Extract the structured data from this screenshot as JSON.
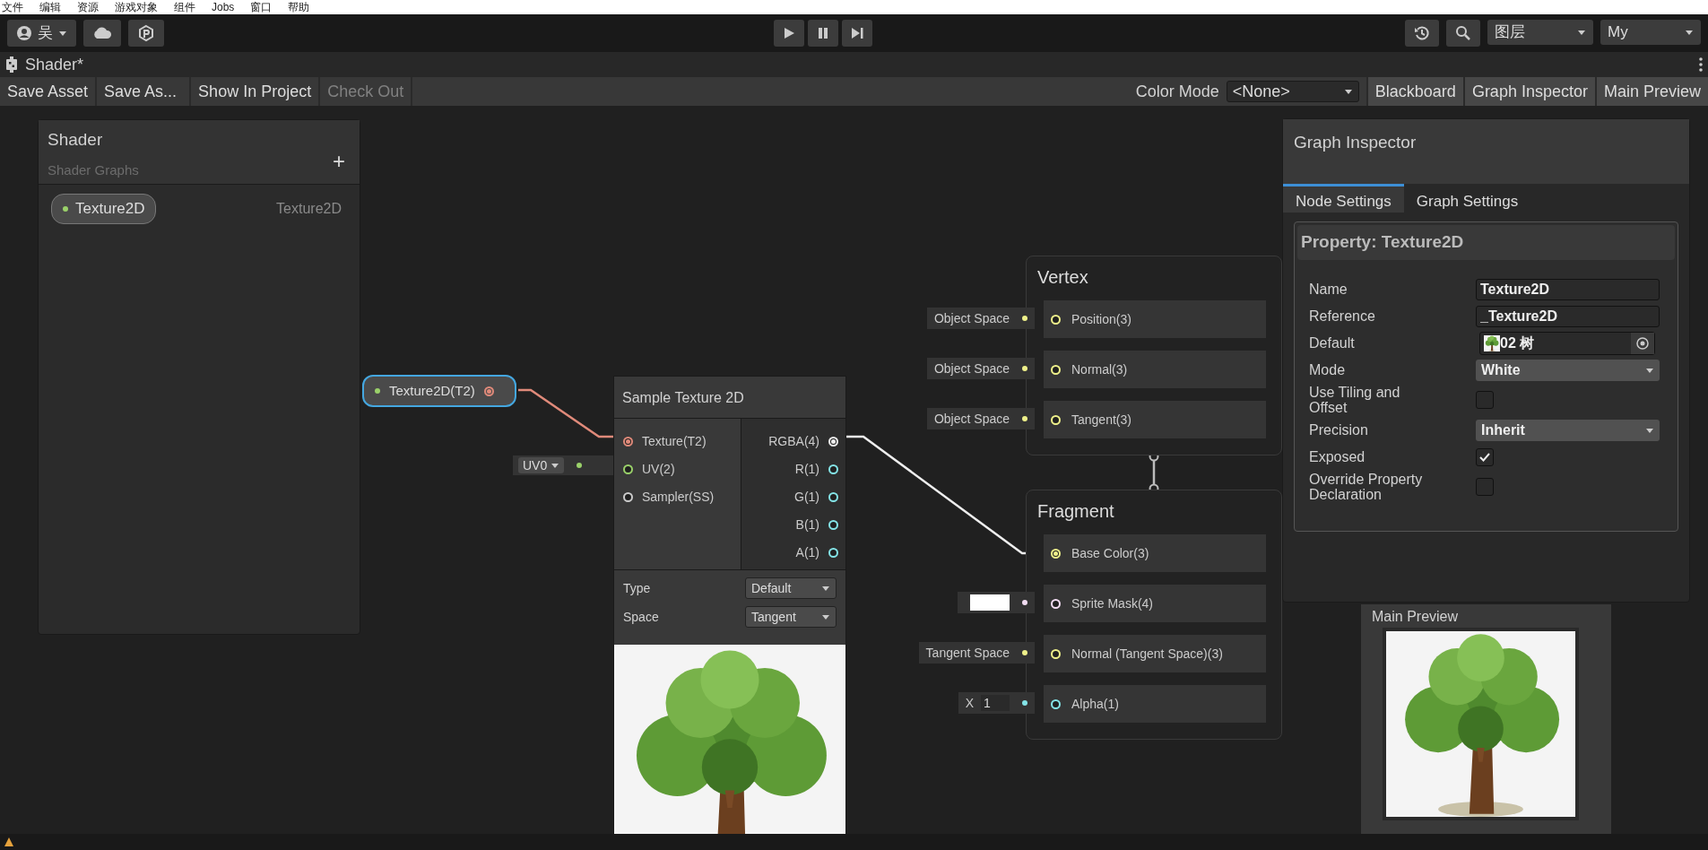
{
  "menu_bar": [
    "文件",
    "编辑",
    "资源",
    "游戏对象",
    "组件",
    "Jobs",
    "窗口",
    "帮助"
  ],
  "toolbar": {
    "account": "吴",
    "layers": "图层",
    "layout": "My"
  },
  "tab": {
    "title": "Shader*"
  },
  "actions": [
    {
      "label": "Save Asset",
      "disabled": false
    },
    {
      "label": "Save As...",
      "disabled": false
    },
    {
      "label": "Show In Project",
      "disabled": false
    },
    {
      "label": "Check Out",
      "disabled": true
    }
  ],
  "color_mode": {
    "label": "Color Mode",
    "value": "<None>"
  },
  "panel_toggles": [
    "Blackboard",
    "Graph Inspector",
    "Main Preview"
  ],
  "blackboard": {
    "title": "Shader",
    "subtitle": "Shader Graphs",
    "add": "+",
    "properties": [
      {
        "name": "Texture2D",
        "type": "Texture2D",
        "color": "#9ad16a"
      }
    ]
  },
  "property_node": {
    "label": "Texture2D(T2)",
    "selected": true,
    "color": "#e08a7a"
  },
  "uv_input": {
    "value": "UV0",
    "color": "#9ad16a"
  },
  "sample_node": {
    "title": "Sample Texture 2D",
    "inputs": [
      {
        "label": "Texture(T2)",
        "color": "#e08a7a",
        "connected": true
      },
      {
        "label": "UV(2)",
        "color": "#9ad16a",
        "connected": false
      },
      {
        "label": "Sampler(SS)",
        "color": "#cccccc",
        "connected": false
      }
    ],
    "outputs": [
      {
        "label": "RGBA(4)",
        "color": "#eeeeee",
        "connected": true
      },
      {
        "label": "R(1)",
        "color": "#84e4e7",
        "connected": false
      },
      {
        "label": "G(1)",
        "color": "#84e4e7",
        "connected": false
      },
      {
        "label": "B(1)",
        "color": "#84e4e7",
        "connected": false
      },
      {
        "label": "A(1)",
        "color": "#84e4e7",
        "connected": false
      }
    ],
    "settings": [
      {
        "label": "Type",
        "value": "Default"
      },
      {
        "label": "Space",
        "value": "Tangent"
      }
    ]
  },
  "vertex": {
    "title": "Vertex",
    "slots": [
      {
        "kind": "space",
        "input": "Object Space",
        "label": "Position(3)",
        "color": "#eef08a"
      },
      {
        "kind": "space",
        "input": "Object Space",
        "label": "Normal(3)",
        "color": "#eef08a"
      },
      {
        "kind": "space",
        "input": "Object Space",
        "label": "Tangent(3)",
        "color": "#eef08a"
      }
    ]
  },
  "fragment": {
    "title": "Fragment",
    "slots": [
      {
        "kind": "wired",
        "label": "Base Color(3)",
        "color": "#eef08a"
      },
      {
        "kind": "swatch",
        "swatch": {
          "color": "#ffffff"
        },
        "label": "Sprite Mask(4)",
        "color": "#f2dcf2"
      },
      {
        "kind": "space",
        "input": "Tangent Space",
        "label": "Normal (Tangent Space)(3)",
        "color": "#eef08a"
      },
      {
        "kind": "float",
        "axis": "X",
        "input": "1",
        "label": "Alpha(1)",
        "color": "#84e4e7"
      }
    ]
  },
  "inspector": {
    "title": "Graph Inspector",
    "tabs": [
      {
        "label": "Node Settings",
        "selected": true
      },
      {
        "label": "Graph Settings",
        "selected": false
      }
    ],
    "section": "Property: Texture2D",
    "fields": [
      {
        "kind": "text",
        "label": "Name",
        "value": "Texture2D"
      },
      {
        "kind": "text",
        "label": "Reference",
        "value": "_Texture2D"
      },
      {
        "kind": "object",
        "label": "Default",
        "value": "02 树"
      },
      {
        "kind": "dropdown",
        "label": "Mode",
        "value": "White"
      },
      {
        "kind": "checkbox",
        "label": "Use Tiling and Offset",
        "checked": false
      },
      {
        "kind": "dropdown",
        "label": "Precision",
        "value": "Inherit"
      },
      {
        "kind": "checkbox",
        "label": "Exposed",
        "checked": true
      },
      {
        "kind": "checkbox",
        "label": "Override Property Declaration",
        "checked": false
      }
    ]
  },
  "main_preview": {
    "title": "Main Preview"
  }
}
